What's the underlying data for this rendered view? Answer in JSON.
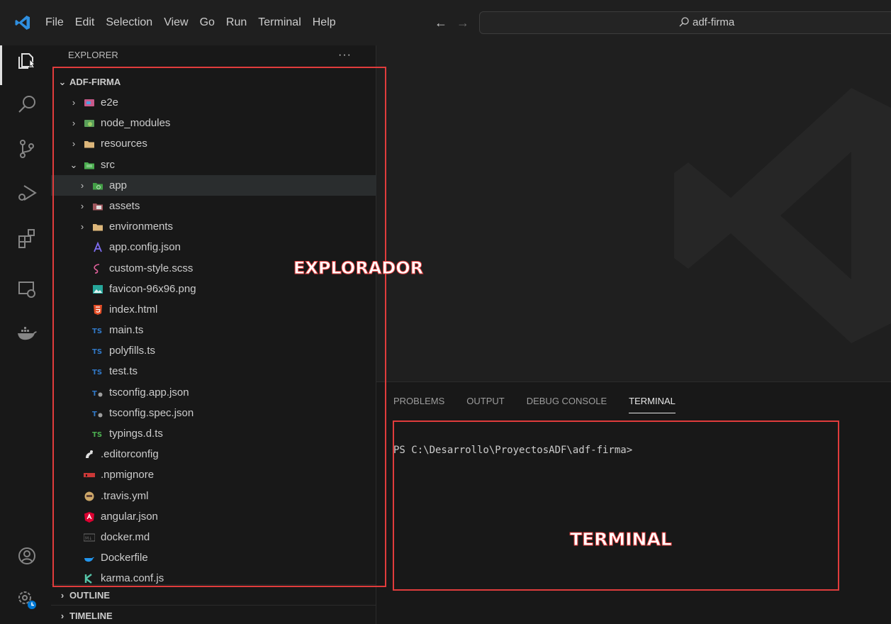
{
  "menubar": {
    "items": [
      "File",
      "Edit",
      "Selection",
      "View",
      "Go",
      "Run",
      "Terminal",
      "Help"
    ]
  },
  "nav": {
    "back": "←",
    "forward": "→"
  },
  "command_center": {
    "text": "adf-firma"
  },
  "explorer": {
    "title": "EXPLORER",
    "more": "···",
    "root": "ADF-FIRMA",
    "items": [
      {
        "label": "e2e",
        "depth": 1,
        "chevron": "›",
        "icon": "e2e-folder-icon"
      },
      {
        "label": "node_modules",
        "depth": 1,
        "chevron": "›",
        "icon": "node-folder-icon"
      },
      {
        "label": "resources",
        "depth": 1,
        "chevron": "›",
        "icon": "folder-icon"
      },
      {
        "label": "src",
        "depth": 1,
        "chevron": "⌄",
        "icon": "src-folder-icon"
      },
      {
        "label": "app",
        "depth": 2,
        "chevron": "›",
        "icon": "app-folder-icon",
        "selected": true
      },
      {
        "label": "assets",
        "depth": 2,
        "chevron": "›",
        "icon": "assets-folder-icon"
      },
      {
        "label": "environments",
        "depth": 2,
        "chevron": "›",
        "icon": "folder-icon"
      },
      {
        "label": "app.config.json",
        "depth": 2,
        "chevron": "",
        "icon": "json-config-icon"
      },
      {
        "label": "custom-style.scss",
        "depth": 2,
        "chevron": "",
        "icon": "scss-icon"
      },
      {
        "label": "favicon-96x96.png",
        "depth": 2,
        "chevron": "",
        "icon": "image-icon"
      },
      {
        "label": "index.html",
        "depth": 2,
        "chevron": "",
        "icon": "html-icon"
      },
      {
        "label": "main.ts",
        "depth": 2,
        "chevron": "",
        "icon": "ts-icon"
      },
      {
        "label": "polyfills.ts",
        "depth": 2,
        "chevron": "",
        "icon": "ts-icon"
      },
      {
        "label": "test.ts",
        "depth": 2,
        "chevron": "",
        "icon": "ts-icon"
      },
      {
        "label": "tsconfig.app.json",
        "depth": 2,
        "chevron": "",
        "icon": "tsconfig-icon"
      },
      {
        "label": "tsconfig.spec.json",
        "depth": 2,
        "chevron": "",
        "icon": "tsconfig-icon"
      },
      {
        "label": "typings.d.ts",
        "depth": 2,
        "chevron": "",
        "icon": "ts-def-icon"
      },
      {
        "label": ".editorconfig",
        "depth": 1,
        "chevron": "",
        "icon": "editorconfig-icon"
      },
      {
        "label": ".npmignore",
        "depth": 1,
        "chevron": "",
        "icon": "npm-icon"
      },
      {
        "label": ".travis.yml",
        "depth": 1,
        "chevron": "",
        "icon": "travis-icon"
      },
      {
        "label": "angular.json",
        "depth": 1,
        "chevron": "",
        "icon": "angular-icon"
      },
      {
        "label": "docker.md",
        "depth": 1,
        "chevron": "",
        "icon": "markdown-icon"
      },
      {
        "label": "Dockerfile",
        "depth": 1,
        "chevron": "",
        "icon": "docker-icon"
      },
      {
        "label": "karma.conf.js",
        "depth": 1,
        "chevron": "",
        "icon": "karma-icon"
      }
    ],
    "sections": [
      "OUTLINE",
      "TIMELINE"
    ]
  },
  "panel": {
    "tabs": [
      "PROBLEMS",
      "OUTPUT",
      "DEBUG CONSOLE",
      "TERMINAL"
    ],
    "active_tab": "TERMINAL",
    "terminal_prompt": "PS C:\\Desarrollo\\ProyectosADF\\adf-firma>"
  },
  "annotations": {
    "explorer_label": "EXPLORADOR",
    "terminal_label": "TERMINAL",
    "color": "#e03c3c"
  },
  "colors": {
    "accent": "#0078d4",
    "background": "#1f1f1f",
    "sidebar": "#181818"
  }
}
